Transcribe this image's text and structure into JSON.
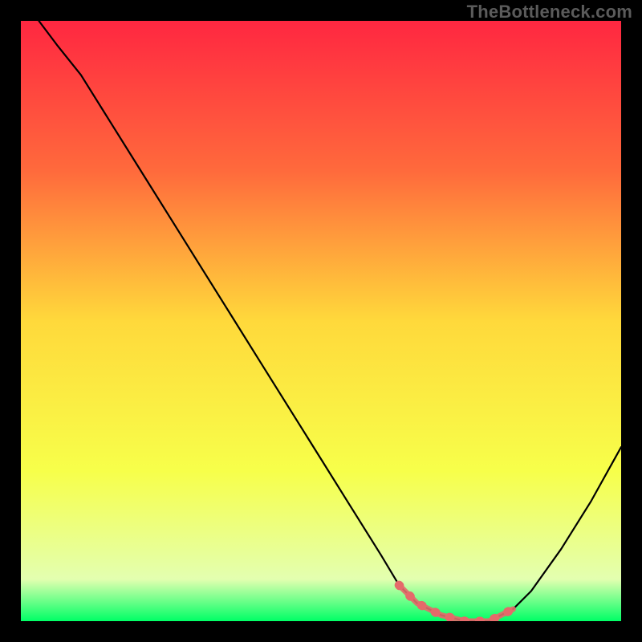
{
  "watermark": "TheBottleneck.com",
  "chart_data": {
    "type": "line",
    "title": "",
    "xlabel": "",
    "ylabel": "",
    "xlim": [
      0,
      100
    ],
    "ylim": [
      0,
      100
    ],
    "grid": false,
    "legend": false,
    "gradient_stops": [
      {
        "offset": 0.0,
        "color": "#ff2741"
      },
      {
        "offset": 0.25,
        "color": "#ff6a3c"
      },
      {
        "offset": 0.5,
        "color": "#ffd93b"
      },
      {
        "offset": 0.75,
        "color": "#f7ff4a"
      },
      {
        "offset": 0.93,
        "color": "#e3ffb0"
      },
      {
        "offset": 1.0,
        "color": "#00ff66"
      }
    ],
    "series": [
      {
        "name": "curve",
        "color": "#000000",
        "x": [
          3,
          6,
          10,
          15,
          20,
          25,
          30,
          35,
          40,
          45,
          50,
          55,
          60,
          63,
          66,
          70,
          74,
          78,
          80,
          82,
          85,
          90,
          95,
          100
        ],
        "values": [
          100,
          96,
          91,
          83,
          75,
          67,
          59,
          51,
          43,
          35,
          27,
          19,
          11,
          6,
          3,
          1,
          0,
          0,
          1,
          2,
          5,
          12,
          20,
          29
        ]
      },
      {
        "name": "highlight",
        "color": "#e46a6a",
        "x": [
          63,
          66,
          70,
          74,
          78,
          80,
          82
        ],
        "values": [
          6,
          3,
          1,
          0,
          0,
          1,
          2
        ]
      }
    ]
  }
}
